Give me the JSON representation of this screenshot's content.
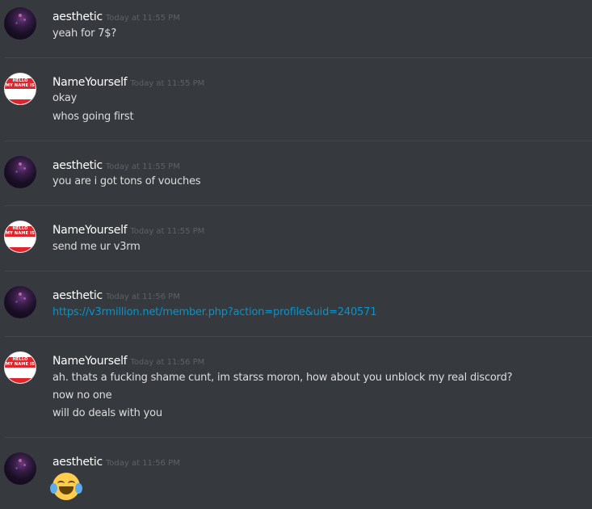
{
  "messages": [
    {
      "username": "aesthetic",
      "timestamp": "Today at 11:55 PM",
      "avatar": "dark-purple-avatar",
      "lines": [
        "yeah for 7$?"
      ]
    },
    {
      "username": "NameYourself",
      "timestamp": "Today at 11:55 PM",
      "avatar": "hello-my-name-is-tag-avatar",
      "lines": [
        "okay",
        "whos going first"
      ]
    },
    {
      "username": "aesthetic",
      "timestamp": "Today at 11:55 PM",
      "avatar": "dark-purple-avatar",
      "lines": [
        "you are i got tons of vouches"
      ]
    },
    {
      "username": "NameYourself",
      "timestamp": "Today at 11:55 PM",
      "avatar": "hello-my-name-is-tag-avatar",
      "lines": [
        "send me ur v3rm"
      ]
    },
    {
      "username": "aesthetic",
      "timestamp": "Today at 11:56 PM",
      "avatar": "dark-purple-avatar",
      "lines": [
        "https://v3rmillion.net/member.php?action=profile&uid=240571"
      ]
    },
    {
      "username": "NameYourself",
      "timestamp": "Today at 11:56 PM",
      "avatar": "hello-my-name-is-tag-avatar",
      "lines": [
        "ah. thats a fucking shame cunt, im starss moron, how about you unblock my real discord?",
        "now no one",
        "will do deals with you"
      ]
    },
    {
      "username": "aesthetic",
      "timestamp": "Today at 11:56 PM",
      "avatar": "dark-purple-avatar",
      "emoji": "joy-emoji"
    }
  ],
  "tag_avatar_text": [
    "HELLO",
    "MY NAME IS"
  ],
  "colors": {
    "background": "#36393e",
    "username": "#ffffff",
    "timestamp": "#5e6167",
    "text": "#dcddde",
    "link": "#0096cf",
    "divider": "#42454a"
  }
}
